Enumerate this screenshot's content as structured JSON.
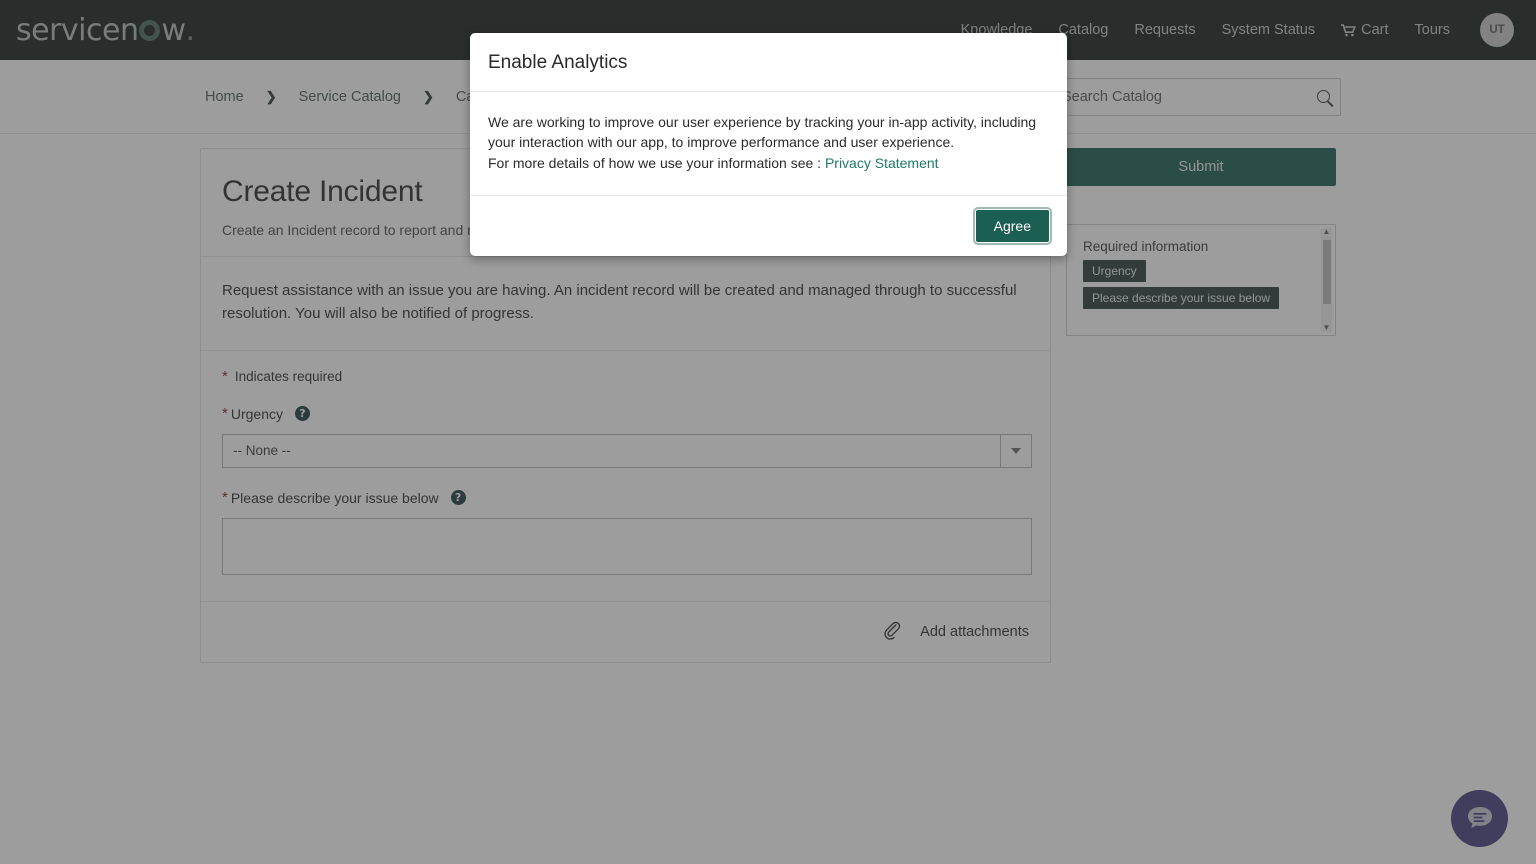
{
  "header": {
    "brand": {
      "pre": "servicen",
      "mark": "o-ring",
      "post": "w",
      "dot": "."
    },
    "nav": [
      {
        "label": "Knowledge",
        "icon": ""
      },
      {
        "label": "Catalog",
        "icon": ""
      },
      {
        "label": "Requests",
        "icon": ""
      },
      {
        "label": "System Status",
        "icon": ""
      },
      {
        "label": "Cart",
        "icon": "cart-icon"
      },
      {
        "label": "Tours",
        "icon": ""
      }
    ],
    "avatar_initials": "UT"
  },
  "breadcrumb": {
    "items": [
      "Home",
      "Service Catalog",
      "Can We"
    ],
    "separator": "❯"
  },
  "search": {
    "value": "",
    "placeholder": "Search Catalog",
    "icon": "search-icon"
  },
  "form": {
    "title": "Create Incident",
    "subtitle": "Create an Incident record to report and re",
    "description": "Request assistance with an issue you are having. An incident record will be created and managed through to successful resolution. You will also be notified of progress.",
    "required_note": "Indicates required",
    "required_marker": "*",
    "fields": [
      {
        "label": "Urgency",
        "help_icon": "question-mark-icon",
        "type": "select",
        "value": "-- None --",
        "options": [
          "-- None --"
        ]
      },
      {
        "label": "Please describe your issue below",
        "help_icon": "question-mark-icon",
        "type": "textarea",
        "value": ""
      }
    ],
    "attachments_label": "Add attachments",
    "attachments_icon": "paperclip-icon"
  },
  "rail": {
    "submit_label": "Submit",
    "required_panel": {
      "title": "Required information",
      "items": [
        "Urgency",
        "Please describe your issue below"
      ]
    }
  },
  "chat": {
    "icon": "chat-bubble-icon",
    "label": "Chat"
  },
  "modal": {
    "title": "Enable Analytics",
    "body_line1": "We are working to improve our user experience by tracking your in-app activity, including your interaction with our app, to improve performance and user experience.",
    "body_line2_prefix": "For more details of how we use your information see : ",
    "privacy_link": "Privacy Statement",
    "agree_label": "Agree"
  },
  "colors": {
    "header_bg": "#16211d",
    "brand_accent": "#4a6b60",
    "primary_button": "#1b5f52",
    "link_teal": "#1f7a6a",
    "required_star": "#8b2020",
    "pill_bg": "#2b3b3b",
    "chat_fab": "#45407c",
    "overlay": "rgba(60,60,60,0.50)"
  }
}
